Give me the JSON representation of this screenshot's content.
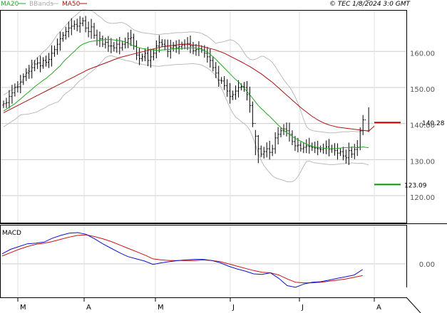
{
  "header": {
    "legend_ma20": "MA20",
    "legend_bbands": "BBands",
    "legend_ma50": "MA50",
    "source": "© TEC 1/8/2024 3:0 GMT"
  },
  "colors": {
    "price": "#000000",
    "ma20": "#22aa22",
    "ma50": "#aa1111",
    "bbands": "#bbbbbb",
    "grid": "#cccccc",
    "macd": "#1111cc",
    "signal": "#cc1111",
    "support": "#009900",
    "resistance": "#cc0000"
  },
  "chart_data": [
    {
      "type": "ohlc",
      "panel": "price",
      "y_ticks": [
        120,
        130,
        140,
        150,
        160
      ],
      "y_tick_labels": [
        "120.00",
        "130.00",
        "140.00",
        "150.00",
        "160.00"
      ],
      "ylim": [
        112.5,
        171.5
      ],
      "x_labels": [
        "M",
        "A",
        "M",
        "J",
        "J",
        "A"
      ],
      "n_bars": 130,
      "price_closes": [
        145.5,
        145.8,
        147.5,
        148.5,
        150,
        150.2,
        151.5,
        153,
        154,
        154.5,
        155.5,
        156.5,
        156.8,
        156,
        157.5,
        157,
        157.8,
        159.5,
        160.5,
        162,
        163.5,
        164.5,
        165.5,
        166.5,
        167,
        167.5,
        167,
        167.8,
        168.5,
        166.5,
        165.5,
        166.8,
        164.5,
        163,
        163.5,
        162,
        162.5,
        161.5,
        161.5,
        161,
        162,
        161,
        162,
        162.5,
        163.5,
        163.8,
        161.5,
        159,
        158,
        158.5,
        159.5,
        157.5,
        158.5,
        159.5,
        161.5,
        162.5,
        162,
        161.5,
        160,
        161,
        161.5,
        161,
        161.3,
        161.8,
        162,
        162.2,
        161.5,
        160.2,
        160.5,
        160.8,
        160.4,
        159.5,
        158.5,
        157.5,
        155.5,
        154,
        152,
        151.8,
        150.5,
        149,
        147.5,
        148,
        149,
        150,
        150.2,
        150,
        148,
        145,
        140,
        136.5,
        133,
        131.5,
        132.2,
        133,
        132,
        133,
        136,
        137,
        138,
        138.5,
        138,
        137,
        135,
        133.8,
        134,
        133,
        133.4,
        133.8,
        133.6,
        133.4,
        133.2,
        133,
        132.8,
        133.1,
        133.5,
        132.9,
        133,
        132.5,
        131.8,
        132.2,
        131,
        130.5,
        132.5,
        131.5,
        132.8,
        133.4,
        138,
        141
      ],
      "ma20": [
        143.5,
        144,
        144.5,
        145,
        145.5,
        146.2,
        146.8,
        147.5,
        148.2,
        148.8,
        149.5,
        150.2,
        150.8,
        151.4,
        152,
        152.5,
        153.2,
        153.8,
        154.6,
        155.3,
        156,
        157,
        157.8,
        158.5,
        159.3,
        160,
        160.8,
        161.5,
        162,
        162.3,
        162.6,
        162.8,
        162.9,
        163,
        163.1,
        163.2,
        163.3,
        163.3,
        163.3,
        163.2,
        163.1,
        163,
        162.9,
        162.6,
        162.3,
        161.9,
        161.5,
        161.2,
        161,
        160.8,
        160.7,
        160.6,
        160.5,
        160.4,
        160.3,
        160.3,
        160.4,
        160.5,
        160.5,
        160.6,
        160.7,
        160.8,
        160.8,
        160.8,
        160.9,
        160.9,
        161,
        161,
        160.9,
        160.8,
        160.6,
        160.2,
        159.8,
        159.2,
        158.5,
        157.8,
        157,
        156.2,
        155.4,
        154.6,
        153.8,
        153,
        152.2,
        151.6,
        150.7,
        149.8,
        148.9,
        148,
        147,
        146,
        145,
        144.2,
        143.5,
        142.7,
        142,
        141.2,
        140.4,
        139.6,
        138.9,
        138.2,
        137.5,
        137,
        136.4,
        135.9,
        135.5,
        135.1,
        134.7,
        134.3,
        134,
        133.7,
        133.5,
        133.4,
        133.3,
        133.2,
        133.1,
        133,
        133,
        133,
        133.1,
        133.2,
        133.3,
        133.3,
        133.3,
        133.5,
        133.4,
        133.3,
        133.4,
        133.5,
        133.4,
        133.3
      ],
      "ma50": [
        143,
        143.4,
        143.8,
        144.2,
        144.6,
        145,
        145.4,
        145.8,
        146.2,
        146.6,
        147,
        147.4,
        147.8,
        148.2,
        148.6,
        149,
        149.4,
        149.8,
        150.2,
        150.6,
        151,
        151.4,
        151.8,
        152.2,
        152.6,
        153,
        153.4,
        153.8,
        154.2,
        154.6,
        155,
        155.3,
        155.6,
        155.9,
        156.2,
        156.5,
        156.8,
        157.1,
        157.4,
        157.7,
        158,
        158.3,
        158.5,
        158.7,
        158.9,
        159.1,
        159.3,
        159.5,
        159.7,
        159.9,
        160.1,
        160.3,
        160.5,
        160.7,
        160.9,
        161.1,
        161.3,
        161.4,
        161.5,
        161.6,
        161.7,
        161.8,
        161.9,
        162,
        162,
        162,
        161.9,
        161.8,
        161.7,
        161.6,
        161.4,
        161.2,
        161,
        160.8,
        160.6,
        160.4,
        160.1,
        159.8,
        159.5,
        159.1,
        158.7,
        158.3,
        157.9,
        157.5,
        157.1,
        156.7,
        156.2,
        155.8,
        155.3,
        154.8,
        154.3,
        153.8,
        153.2,
        152.6,
        152,
        151.4,
        150.7,
        150,
        149.3,
        148.6,
        147.9,
        147.2,
        146.5,
        145.8,
        145.1,
        144.4,
        143.8,
        143.2,
        142.6,
        142,
        141.5,
        141,
        140.6,
        140.2,
        139.9,
        139.6,
        139.4,
        139.2,
        139,
        138.9,
        138.8,
        138.7,
        138.6,
        138.5,
        138.4,
        138.3,
        138.2,
        138.1,
        138,
        137.9,
        138.6,
        139.3
      ],
      "bb_upper_top": 169,
      "bb_lower_bottom": 125,
      "levels": [
        {
          "value": 140.28,
          "label": "140.28",
          "kind": "resistance"
        },
        {
          "value": 123.09,
          "label": "123.09",
          "kind": "support"
        }
      ]
    },
    {
      "type": "line",
      "panel": "macd",
      "title": "MACD",
      "y_ticks": [
        0
      ],
      "y_tick_labels": [
        "0.00"
      ],
      "ylim": [
        -6,
        7
      ],
      "macd_points": [
        [
          0,
          1.8
        ],
        [
          12,
          2.6
        ],
        [
          24,
          3.1
        ],
        [
          36,
          3.6
        ],
        [
          48,
          3.7
        ],
        [
          60,
          3.9
        ],
        [
          72,
          4.6
        ],
        [
          84,
          5.1
        ],
        [
          96,
          5.5
        ],
        [
          108,
          5.6
        ],
        [
          120,
          5.3
        ],
        [
          132,
          4.5
        ],
        [
          144,
          3.6
        ],
        [
          156,
          2.8
        ],
        [
          168,
          2.0
        ],
        [
          180,
          1.3
        ],
        [
          192,
          0.9
        ],
        [
          204,
          0.5
        ],
        [
          216,
          -0.1
        ],
        [
          228,
          0.2
        ],
        [
          240,
          0.4
        ],
        [
          252,
          0.6
        ],
        [
          264,
          0.7
        ],
        [
          276,
          0.8
        ],
        [
          288,
          0.8
        ],
        [
          300,
          0.6
        ],
        [
          312,
          0.2
        ],
        [
          324,
          -0.4
        ],
        [
          336,
          -0.9
        ],
        [
          348,
          -1.3
        ],
        [
          360,
          -1.8
        ],
        [
          372,
          -1.9
        ],
        [
          384,
          -1.6
        ],
        [
          396,
          -2.6
        ],
        [
          408,
          -3.9
        ],
        [
          420,
          -4.2
        ],
        [
          432,
          -3.6
        ],
        [
          444,
          -3.3
        ],
        [
          456,
          -3.2
        ],
        [
          468,
          -2.9
        ],
        [
          480,
          -2.6
        ],
        [
          492,
          -2.3
        ],
        [
          504,
          -2.0
        ],
        [
          516,
          -1.0
        ]
      ],
      "signal_points": [
        [
          0,
          1.4
        ],
        [
          12,
          2.0
        ],
        [
          24,
          2.6
        ],
        [
          36,
          3.1
        ],
        [
          48,
          3.5
        ],
        [
          60,
          3.7
        ],
        [
          72,
          4.0
        ],
        [
          84,
          4.4
        ],
        [
          96,
          4.8
        ],
        [
          108,
          5.1
        ],
        [
          120,
          5.2
        ],
        [
          132,
          4.9
        ],
        [
          144,
          4.5
        ],
        [
          156,
          4.0
        ],
        [
          168,
          3.4
        ],
        [
          180,
          2.8
        ],
        [
          192,
          2.2
        ],
        [
          204,
          1.6
        ],
        [
          216,
          0.9
        ],
        [
          228,
          0.7
        ],
        [
          240,
          0.6
        ],
        [
          252,
          0.6
        ],
        [
          264,
          0.6
        ],
        [
          276,
          0.6
        ],
        [
          288,
          0.7
        ],
        [
          300,
          0.6
        ],
        [
          312,
          0.4
        ],
        [
          324,
          0.0
        ],
        [
          336,
          -0.4
        ],
        [
          348,
          -0.8
        ],
        [
          360,
          -1.2
        ],
        [
          372,
          -1.5
        ],
        [
          384,
          -1.6
        ],
        [
          396,
          -2.0
        ],
        [
          408,
          -2.7
        ],
        [
          420,
          -3.3
        ],
        [
          432,
          -3.4
        ],
        [
          444,
          -3.4
        ],
        [
          456,
          -3.3
        ],
        [
          468,
          -3.1
        ],
        [
          480,
          -2.9
        ],
        [
          492,
          -2.7
        ],
        [
          504,
          -2.4
        ],
        [
          516,
          -2.1
        ]
      ]
    }
  ]
}
